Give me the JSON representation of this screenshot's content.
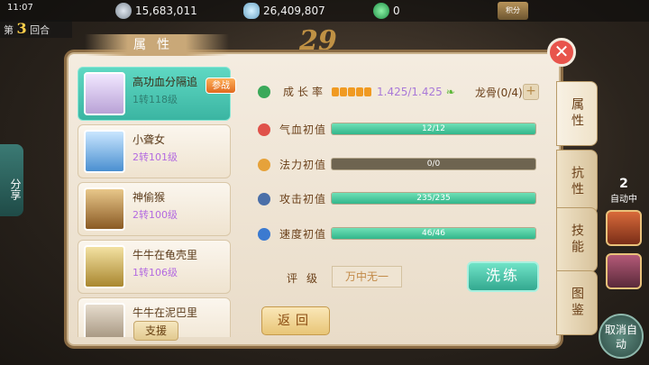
{
  "status": {
    "time": "11:07"
  },
  "currency": {
    "silver": "15,683,011",
    "gold": "26,409,807",
    "gem": "0"
  },
  "top_button": "积分",
  "round": {
    "prefix": "第",
    "number": "3",
    "suffix": "回合"
  },
  "overlay_number": "29",
  "share_label": "分享",
  "panel": {
    "title": "属性",
    "close_icon": "close-icon"
  },
  "characters": [
    {
      "name": "高功血分隔追",
      "level": "1转118级",
      "tag": "参战",
      "active": true
    },
    {
      "name": "小聋女",
      "level": "2转101级"
    },
    {
      "name": "神偷猴",
      "level": "2转100级"
    },
    {
      "name": "牛牛在龟壳里",
      "level": "1转106级"
    },
    {
      "name": "牛牛在泥巴里",
      "level": ""
    }
  ],
  "support_label": "支援",
  "growth": {
    "label": "成长率",
    "value": "1.425/1.425",
    "pips": 5
  },
  "dragon_bone": {
    "label": "龙骨(0/4)",
    "plus": "+"
  },
  "stats": [
    {
      "label": "气血初值",
      "value": "12/12",
      "fill": 1.0,
      "icon": "heart-icon",
      "color": "#e0524a"
    },
    {
      "label": "法力初值",
      "value": "0/0",
      "fill": 0.0,
      "icon": "mana-icon",
      "color": "#e6a23a"
    },
    {
      "label": "攻击初值",
      "value": "235/235",
      "fill": 1.0,
      "icon": "sword-icon",
      "color": "#4a6fa8"
    },
    {
      "label": "速度初值",
      "value": "46/46",
      "fill": 1.0,
      "icon": "speed-icon",
      "color": "#3b7ad0"
    }
  ],
  "rating": {
    "label": "评级",
    "value": "万中无一"
  },
  "wash_button": "洗练",
  "back_button": "返回",
  "tabs": [
    {
      "label": "属性",
      "active": true
    },
    {
      "label": "抗性"
    },
    {
      "label": "技能"
    },
    {
      "label": "图鉴"
    }
  ],
  "side_right": {
    "count": "2",
    "label": "自动中"
  },
  "cancel_auto": "取消自动"
}
